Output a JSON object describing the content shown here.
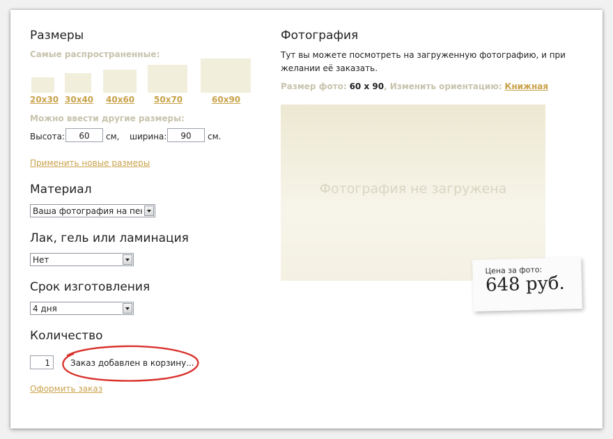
{
  "left": {
    "sizes_title": "Размеры",
    "common_label": "Самые распространенные:",
    "sizes": [
      "20x30",
      "30x40",
      "40x60",
      "50x70",
      "60x90"
    ],
    "custom_label": "Можно ввести другие размеры:",
    "height_label": "Высота:",
    "height_value": "60",
    "height_unit": "см,",
    "width_label": "ширина:",
    "width_value": "90",
    "width_unit": "см.",
    "apply_link": "Применить новые размеры",
    "material_title": "Материал",
    "material_value": "Ваша фотография на пенокартоне",
    "finish_title": "Лак, гель или ламинация",
    "finish_value": "Нет",
    "term_title": "Срок изготовления",
    "term_value": "4 дня",
    "qty_title": "Количество",
    "qty_value": "1",
    "cart_status": "Заказ добавлен в корзину...",
    "order_link": "Оформить заказ"
  },
  "right": {
    "photo_title": "Фотография",
    "description": [
      "Тут вы можете посмотреть на загруженную фотографию, и при",
      "желании её заказать."
    ],
    "size_label": "Размер фото:",
    "size_value": "60 x 90",
    "orientation_label": ", Изменить ориентацию:",
    "orientation_link": "Книжная",
    "placeholder": "Фотография не загружена",
    "price_label": "Цена за фото:",
    "price_value": "648 руб."
  },
  "colors": {
    "accent_link": "#c9a24a",
    "muted_label": "#c8c3ad",
    "swatch": "#f1eedb",
    "annotation_circle": "#d9322c"
  }
}
